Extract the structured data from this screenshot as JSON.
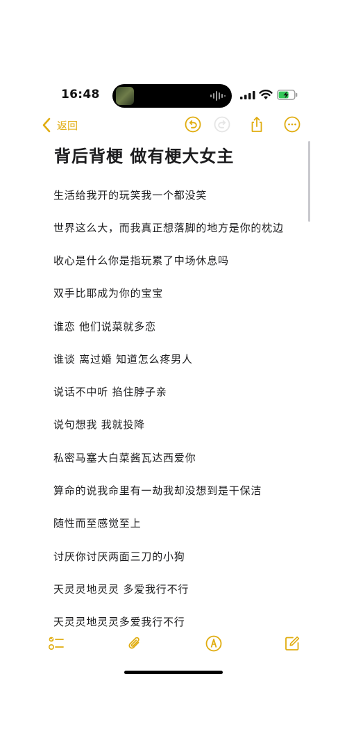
{
  "status_bar": {
    "time": "16:48"
  },
  "nav": {
    "back_label": "返回",
    "icons": [
      "undo-icon",
      "redo-icon",
      "share-icon",
      "more-icon"
    ]
  },
  "note": {
    "title": "背后背梗 做有梗大女主",
    "lines": [
      "生活给我开的玩笑我一个都没笑",
      "世界这么大，而我真正想落脚的地方是你的枕边",
      "收心是什么你是指玩累了中场休息吗",
      "双手比耶成为你的宝宝",
      "谁恋 他们说菜就多恋",
      "谁谈 离过婚 知道怎么疼男人",
      "说话不中听 掐住脖子亲",
      "说句想我 我就投降",
      "私密马塞大白菜酱瓦达西爱你",
      "算命的说我命里有一劫我却没想到是干保洁",
      "随性而至感觉至上",
      "讨厌你讨厌两面三刀的小狗",
      "天灵灵地灵灵 多爱我行不行",
      "天灵灵地灵灵多爱我行不行"
    ]
  },
  "toolbar": {
    "icons": [
      "checklist-icon",
      "attachment-icon",
      "markup-icon",
      "compose-icon"
    ]
  },
  "colors": {
    "accent": "#e0ac0f",
    "text": "#1c1c1e",
    "background": "#ffffff"
  }
}
